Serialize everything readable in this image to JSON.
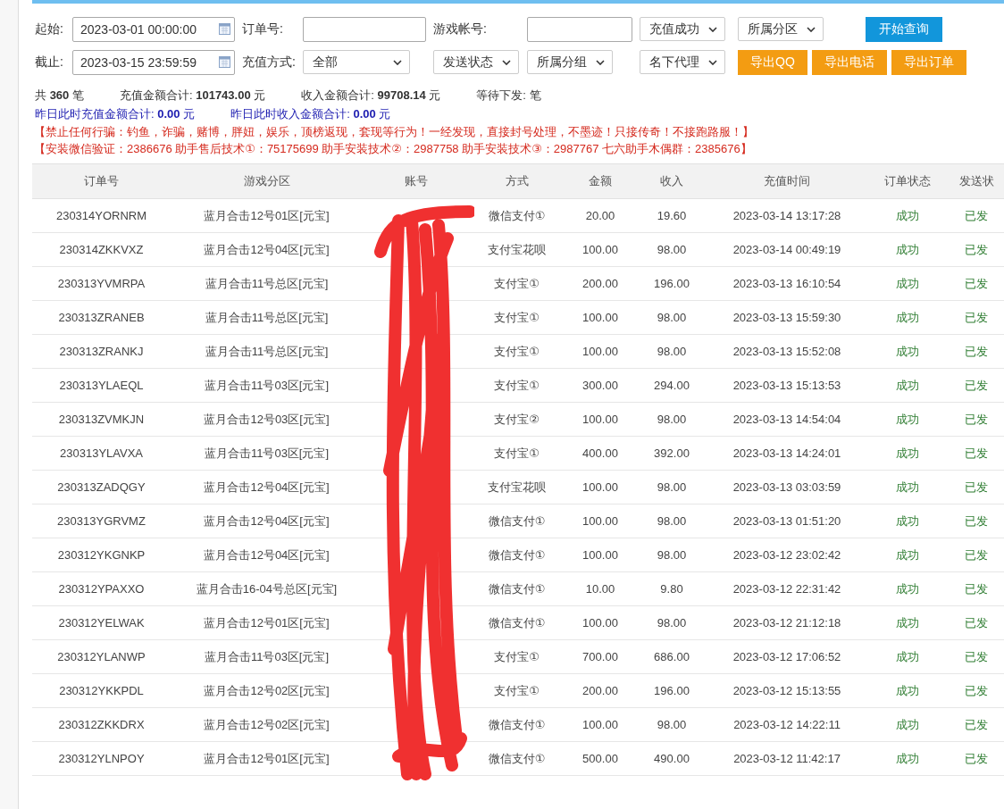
{
  "filters": {
    "rows": [
      [
        {
          "kind": "label",
          "text": "起始:"
        },
        {
          "kind": "date",
          "value": "2023-03-01 00:00:00"
        },
        {
          "kind": "label",
          "text": "订单号:"
        },
        {
          "kind": "text"
        },
        {
          "kind": "label",
          "text": "游戏帐号:"
        },
        {
          "kind": "text"
        },
        {
          "kind": "group",
          "items": [
            {
              "kind": "select",
              "value": "充值成功"
            },
            {
              "kind": "select",
              "value": "所属分区"
            },
            {
              "kind": "primary",
              "text": "开始查询"
            }
          ]
        }
      ],
      [
        {
          "kind": "label",
          "text": "截止:"
        },
        {
          "kind": "date",
          "value": "2023-03-15 23:59:59"
        },
        {
          "kind": "label",
          "text": "充值方式:"
        },
        {
          "kind": "select",
          "value": "全部"
        },
        {
          "kind": "select",
          "value": "发送状态"
        },
        {
          "kind": "select",
          "value": "所属分组"
        },
        {
          "kind": "group",
          "items": [
            {
              "kind": "select",
              "value": "名下代理"
            },
            {
              "kind": "export",
              "text": "导出QQ"
            },
            {
              "kind": "export",
              "text": "导出电话"
            },
            {
              "kind": "export",
              "text": "导出订单"
            }
          ]
        }
      ]
    ]
  },
  "summary": [
    "共 **360** 笔",
    "充值金额合计: **101743.00** 元",
    "收入金额合计: **99708.14** 元",
    "等待下发: 笔"
  ],
  "yesterday": [
    "昨日此时充值金额合计: **0.00** 元",
    "昨日此时收入金额合计: **0.00** 元"
  ],
  "notices": [
    "【禁止任何行骗：钓鱼，诈骗，赌博，胖妞，娱乐，顶榜返现，套现等行为！一经发现，直接封号处理，不墨迹！只接传奇！不接跑路服！】",
    "【安装微信验证：2386676 助手售后技术①：75175699 助手安装技术②：2987758 助手安装技术③：2987767 七六助手木偶群：2385676】"
  ],
  "table": {
    "columns": [
      "订单号",
      "游戏分区",
      "账号",
      "方式",
      "金额",
      "收入",
      "充值时间",
      "订单状态",
      "发送状"
    ],
    "rows": [
      [
        "230314YORNRM",
        "蓝月合击12号01区[元宝]",
        "",
        "微信支付①",
        "20.00",
        "19.60",
        "2023-03-14 13:17:28",
        "成功",
        "已发"
      ],
      [
        "230314ZKKVXZ",
        "蓝月合击12号04区[元宝]",
        "",
        "支付宝花呗",
        "100.00",
        "98.00",
        "2023-03-14 00:49:19",
        "成功",
        "已发"
      ],
      [
        "230313YVMRPA",
        "蓝月合击11号总区[元宝]",
        "",
        "支付宝①",
        "200.00",
        "196.00",
        "2023-03-13 16:10:54",
        "成功",
        "已发"
      ],
      [
        "230313ZRANEB",
        "蓝月合击11号总区[元宝]",
        "",
        "支付宝①",
        "100.00",
        "98.00",
        "2023-03-13 15:59:30",
        "成功",
        "已发"
      ],
      [
        "230313ZRANKJ",
        "蓝月合击11号总区[元宝]",
        "",
        "支付宝①",
        "100.00",
        "98.00",
        "2023-03-13 15:52:08",
        "成功",
        "已发"
      ],
      [
        "230313YLAEQL",
        "蓝月合击11号03区[元宝]",
        "",
        "支付宝①",
        "300.00",
        "294.00",
        "2023-03-13 15:13:53",
        "成功",
        "已发"
      ],
      [
        "230313ZVMKJN",
        "蓝月合击12号03区[元宝]",
        "",
        "支付宝②",
        "100.00",
        "98.00",
        "2023-03-13 14:54:04",
        "成功",
        "已发"
      ],
      [
        "230313YLAVXA",
        "蓝月合击11号03区[元宝]",
        "",
        "支付宝①",
        "400.00",
        "392.00",
        "2023-03-13 14:24:01",
        "成功",
        "已发"
      ],
      [
        "230313ZADQGY",
        "蓝月合击12号04区[元宝]",
        "",
        "支付宝花呗",
        "100.00",
        "98.00",
        "2023-03-13 03:03:59",
        "成功",
        "已发"
      ],
      [
        "230313YGRVMZ",
        "蓝月合击12号04区[元宝]",
        "",
        "微信支付①",
        "100.00",
        "98.00",
        "2023-03-13 01:51:20",
        "成功",
        "已发"
      ],
      [
        "230312YKGNKP",
        "蓝月合击12号04区[元宝]",
        "",
        "微信支付①",
        "100.00",
        "98.00",
        "2023-03-12 23:02:42",
        "成功",
        "已发"
      ],
      [
        "230312YPAXXO",
        "蓝月合击16-04号总区[元宝]",
        "",
        "微信支付①",
        "10.00",
        "9.80",
        "2023-03-12 22:31:42",
        "成功",
        "已发"
      ],
      [
        "230312YELWAK",
        "蓝月合击12号01区[元宝]",
        "",
        "微信支付①",
        "100.00",
        "98.00",
        "2023-03-12 21:12:18",
        "成功",
        "已发"
      ],
      [
        "230312YLANWP",
        "蓝月合击11号03区[元宝]",
        "",
        "支付宝①",
        "700.00",
        "686.00",
        "2023-03-12 17:06:52",
        "成功",
        "已发"
      ],
      [
        "230312YKKPDL",
        "蓝月合击12号02区[元宝]",
        "",
        "支付宝①",
        "200.00",
        "196.00",
        "2023-03-12 15:13:55",
        "成功",
        "已发"
      ],
      [
        "230312ZKKDRX",
        "蓝月合击12号02区[元宝]",
        "",
        "微信支付①",
        "100.00",
        "98.00",
        "2023-03-12 14:22:11",
        "成功",
        "已发"
      ],
      [
        "230312YLNPOY",
        "蓝月合击12号01区[元宝]",
        "",
        "微信支付①",
        "500.00",
        "490.00",
        "2023-03-12 11:42:17",
        "成功",
        "已发"
      ]
    ]
  }
}
